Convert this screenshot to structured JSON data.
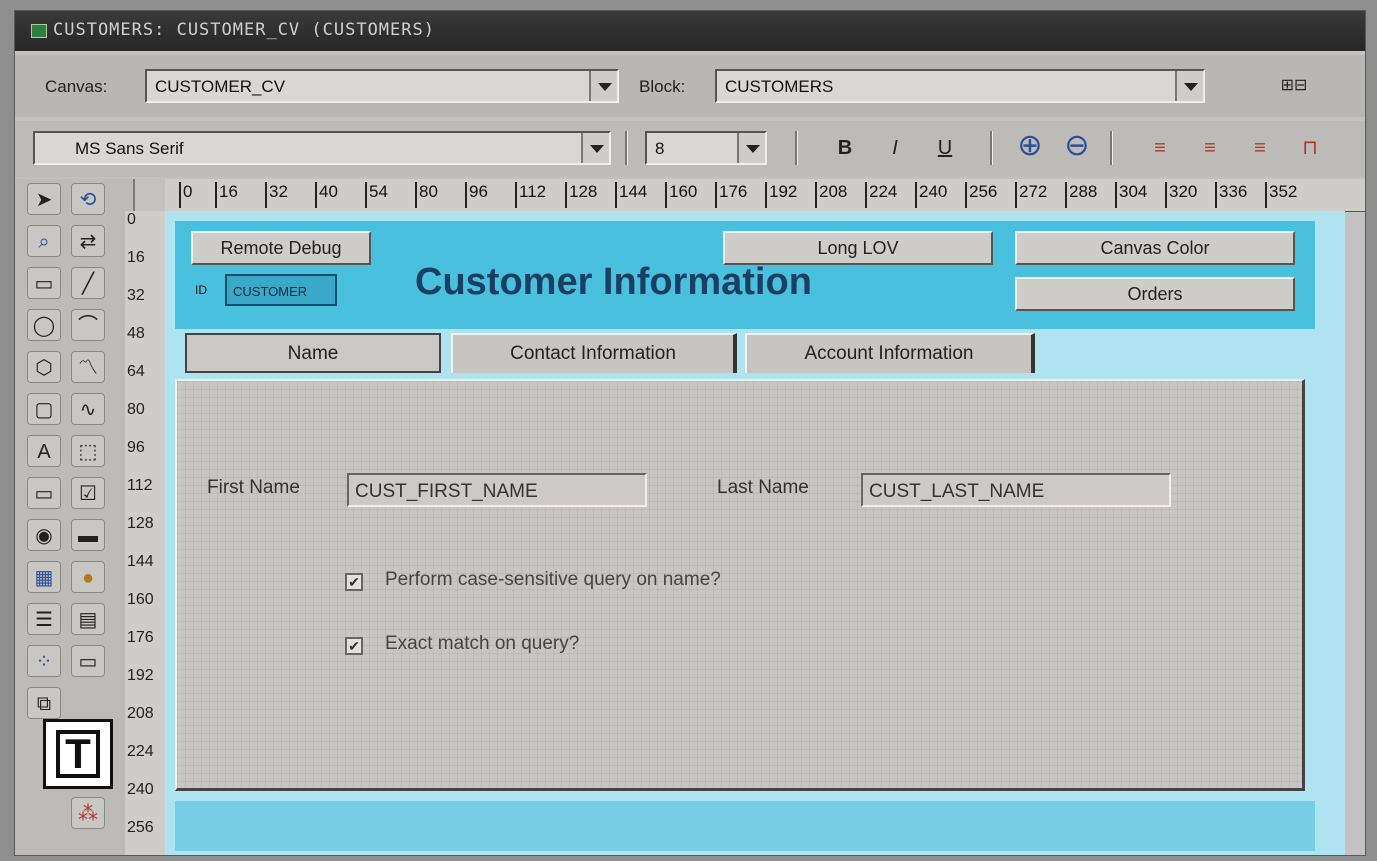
{
  "window": {
    "title": "CUSTOMERS: CUSTOMER_CV (CUSTOMERS)"
  },
  "toolbar": {
    "canvas_label": "Canvas:",
    "canvas_value": "CUSTOMER_CV",
    "block_label": "Block:",
    "block_value": "CUSTOMERS",
    "font_value": "MS Sans Serif",
    "size_value": "8",
    "bold": "B",
    "italic": "I",
    "underline": "U"
  },
  "ruler": {
    "top": [
      "0",
      "16",
      "32",
      "40",
      "54",
      "80",
      "96",
      "112",
      "128",
      "144",
      "160",
      "176",
      "192",
      "208",
      "224",
      "240",
      "256",
      "272",
      "288",
      "304",
      "320",
      "336",
      "352"
    ],
    "left": [
      "0",
      "16",
      "32",
      "48",
      "64",
      "80",
      "96",
      "112",
      "128",
      "144",
      "160",
      "176",
      "192",
      "208",
      "224",
      "240",
      "256"
    ]
  },
  "header": {
    "title": "Customer Information",
    "remote_debug": "Remote Debug",
    "long_lov": "Long LOV",
    "canvas_color": "Canvas Color",
    "orders": "Orders",
    "id_label": "ID",
    "id_value": "CUSTOMER"
  },
  "tabs": [
    "Name",
    "Contact Information",
    "Account Information"
  ],
  "form": {
    "first_name_label": "First Name",
    "first_name_value": "CUST_FIRST_NAME",
    "last_name_label": "Last Name",
    "last_name_value": "CUST_LAST_NAME",
    "case_sensitive_label": "Perform case-sensitive query on name?",
    "case_sensitive_checked": true,
    "exact_match_label": "Exact match on query?",
    "exact_match_checked": true
  },
  "colors": {
    "header_bg": "#49c0de",
    "canvas_bg": "#aee3ef",
    "title_color": "#1b3f63",
    "panel_bg": "#c8c6c3"
  }
}
